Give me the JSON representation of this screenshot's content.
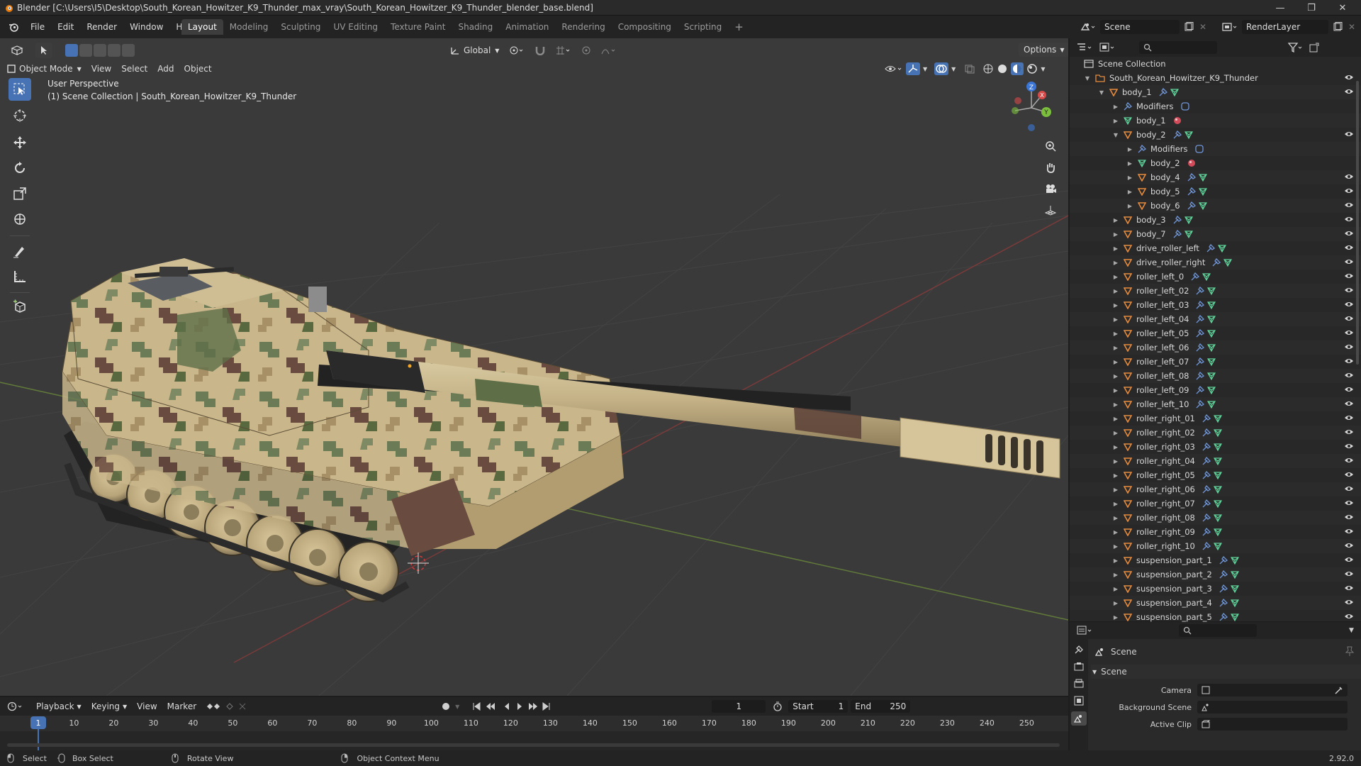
{
  "window": {
    "title": "Blender [C:\\Users\\I5\\Desktop\\South_Korean_Howitzer_K9_Thunder_max_vray\\South_Korean_Howitzer_K9_Thunder_blender_base.blend]",
    "controls": [
      "—",
      "❐",
      "✕"
    ]
  },
  "menubar": {
    "items": [
      "File",
      "Edit",
      "Render",
      "Window",
      "Help"
    ]
  },
  "workspaces": {
    "tabs": [
      "Layout",
      "Modeling",
      "Sculpting",
      "UV Editing",
      "Texture Paint",
      "Shading",
      "Animation",
      "Rendering",
      "Compositing",
      "Scripting"
    ],
    "active": "Layout",
    "add": "+"
  },
  "scene_selector": {
    "value": "Scene"
  },
  "layer_selector": {
    "value": "RenderLayer"
  },
  "viewport_header": {
    "mode": "Object Mode",
    "menus": [
      "View",
      "Select",
      "Add",
      "Object"
    ],
    "orientation": "Global",
    "options": "Options"
  },
  "viewport": {
    "perspective": "User Perspective",
    "collection_info": "(1) Scene Collection | South_Korean_Howitzer_K9_Thunder",
    "gizmo": {
      "x": "X",
      "y": "Y",
      "z": "Z"
    }
  },
  "outliner": {
    "root": "Scene Collection",
    "items": [
      {
        "label": "South_Korean_Howitzer_K9_Thunder",
        "depth": 0,
        "expanded": true,
        "type": "collection",
        "eye": true
      },
      {
        "label": "body_1",
        "depth": 1,
        "expanded": true,
        "type": "object",
        "eye": true
      },
      {
        "label": "Modifiers",
        "depth": 2,
        "expanded": false,
        "type": "modifiers",
        "eye": false
      },
      {
        "label": "body_1",
        "depth": 2,
        "expanded": false,
        "type": "mesh",
        "eye": false
      },
      {
        "label": "body_2",
        "depth": 2,
        "expanded": true,
        "type": "object",
        "eye": true
      },
      {
        "label": "Modifiers",
        "depth": 3,
        "expanded": false,
        "type": "modifiers",
        "eye": false
      },
      {
        "label": "body_2",
        "depth": 3,
        "expanded": false,
        "type": "mesh",
        "eye": false
      },
      {
        "label": "body_4",
        "depth": 3,
        "expanded": false,
        "type": "object",
        "eye": true
      },
      {
        "label": "body_5",
        "depth": 3,
        "expanded": false,
        "type": "object",
        "eye": true
      },
      {
        "label": "body_6",
        "depth": 3,
        "expanded": false,
        "type": "object",
        "eye": true
      },
      {
        "label": "body_3",
        "depth": 2,
        "expanded": false,
        "type": "object",
        "eye": true
      },
      {
        "label": "body_7",
        "depth": 2,
        "expanded": false,
        "type": "object",
        "eye": true
      },
      {
        "label": "drive_roller_left",
        "depth": 2,
        "expanded": false,
        "type": "object",
        "eye": true
      },
      {
        "label": "drive_roller_right",
        "depth": 2,
        "expanded": false,
        "type": "object",
        "eye": true
      },
      {
        "label": "roller_left_0",
        "depth": 2,
        "expanded": false,
        "type": "object",
        "eye": true
      },
      {
        "label": "roller_left_02",
        "depth": 2,
        "expanded": false,
        "type": "object",
        "eye": true
      },
      {
        "label": "roller_left_03",
        "depth": 2,
        "expanded": false,
        "type": "object",
        "eye": true
      },
      {
        "label": "roller_left_04",
        "depth": 2,
        "expanded": false,
        "type": "object",
        "eye": true
      },
      {
        "label": "roller_left_05",
        "depth": 2,
        "expanded": false,
        "type": "object",
        "eye": true
      },
      {
        "label": "roller_left_06",
        "depth": 2,
        "expanded": false,
        "type": "object",
        "eye": true
      },
      {
        "label": "roller_left_07",
        "depth": 2,
        "expanded": false,
        "type": "object",
        "eye": true
      },
      {
        "label": "roller_left_08",
        "depth": 2,
        "expanded": false,
        "type": "object",
        "eye": true
      },
      {
        "label": "roller_left_09",
        "depth": 2,
        "expanded": false,
        "type": "object",
        "eye": true
      },
      {
        "label": "roller_left_10",
        "depth": 2,
        "expanded": false,
        "type": "object",
        "eye": true
      },
      {
        "label": "roller_right_01",
        "depth": 2,
        "expanded": false,
        "type": "object",
        "eye": true
      },
      {
        "label": "roller_right_02",
        "depth": 2,
        "expanded": false,
        "type": "object",
        "eye": true
      },
      {
        "label": "roller_right_03",
        "depth": 2,
        "expanded": false,
        "type": "object",
        "eye": true
      },
      {
        "label": "roller_right_04",
        "depth": 2,
        "expanded": false,
        "type": "object",
        "eye": true
      },
      {
        "label": "roller_right_05",
        "depth": 2,
        "expanded": false,
        "type": "object",
        "eye": true
      },
      {
        "label": "roller_right_06",
        "depth": 2,
        "expanded": false,
        "type": "object",
        "eye": true
      },
      {
        "label": "roller_right_07",
        "depth": 2,
        "expanded": false,
        "type": "object",
        "eye": true
      },
      {
        "label": "roller_right_08",
        "depth": 2,
        "expanded": false,
        "type": "object",
        "eye": true
      },
      {
        "label": "roller_right_09",
        "depth": 2,
        "expanded": false,
        "type": "object",
        "eye": true
      },
      {
        "label": "roller_right_10",
        "depth": 2,
        "expanded": false,
        "type": "object",
        "eye": true
      },
      {
        "label": "suspension_part_1",
        "depth": 2,
        "expanded": false,
        "type": "object",
        "eye": true
      },
      {
        "label": "suspension_part_2",
        "depth": 2,
        "expanded": false,
        "type": "object",
        "eye": true
      },
      {
        "label": "suspension_part_3",
        "depth": 2,
        "expanded": false,
        "type": "object",
        "eye": true
      },
      {
        "label": "suspension_part_4",
        "depth": 2,
        "expanded": false,
        "type": "object",
        "eye": true
      },
      {
        "label": "suspension_part_5",
        "depth": 2,
        "expanded": false,
        "type": "object",
        "eye": true
      }
    ]
  },
  "properties": {
    "context": "Scene",
    "panel": "Scene",
    "fields": [
      {
        "label": "Camera",
        "value": ""
      },
      {
        "label": "Background Scene",
        "value": ""
      },
      {
        "label": "Active Clip",
        "value": ""
      }
    ]
  },
  "timeline": {
    "menus": [
      "Playback",
      "Keying",
      "View",
      "Marker"
    ],
    "current_frame": "1",
    "start_label": "Start",
    "start": "1",
    "end_label": "End",
    "end": "250",
    "ticks": [
      "1",
      "10",
      "20",
      "30",
      "40",
      "50",
      "60",
      "70",
      "80",
      "90",
      "100",
      "110",
      "120",
      "130",
      "140",
      "150",
      "160",
      "170",
      "180",
      "190",
      "200",
      "210",
      "220",
      "230",
      "240",
      "250"
    ]
  },
  "statusbar": {
    "select": "Select",
    "box_select": "Box Select",
    "rotate": "Rotate View",
    "context_menu": "Object Context Menu",
    "version": "2.92.0"
  },
  "colors": {
    "accent": "#4772b3",
    "object_orange": "#e68a3c",
    "mesh_green": "#5fd49b",
    "modifier_blue": "#6f96d8",
    "camo_sand": "#c8b48a",
    "camo_green": "#6a7a55",
    "camo_brown": "#6a4a3e"
  }
}
